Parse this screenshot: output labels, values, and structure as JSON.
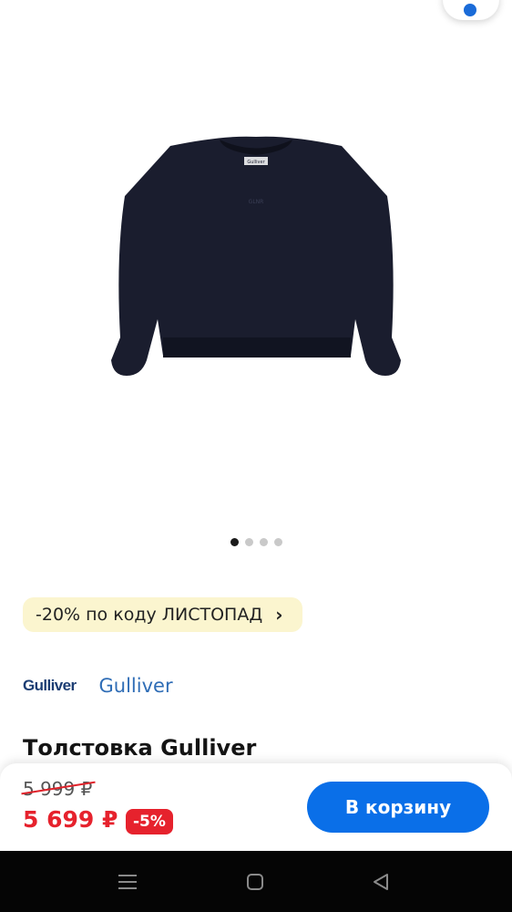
{
  "gallery": {
    "image_count": 4,
    "active_index": 0,
    "image_logo_text": "GLNR",
    "image_tag_text": "Gulliver"
  },
  "promo": {
    "text": "-20% по коду ЛИСТОПАД",
    "chevron": "›"
  },
  "brand": {
    "logo_text": "Gulliver",
    "name": "Gulliver"
  },
  "product": {
    "title": "Толстовка Gulliver"
  },
  "pricing": {
    "old_price": "5 999 ₽",
    "price": "5 699 ₽",
    "discount_badge": "-5%"
  },
  "actions": {
    "add_to_cart": "В корзину"
  },
  "system_nav": {
    "icons": [
      "menu-icon",
      "home-icon",
      "back-icon"
    ]
  },
  "colors": {
    "accent": "#0a6fe8",
    "price_red": "#e6222d",
    "promo_bg": "#fbf5cf",
    "brand_link": "#2f6db6"
  }
}
